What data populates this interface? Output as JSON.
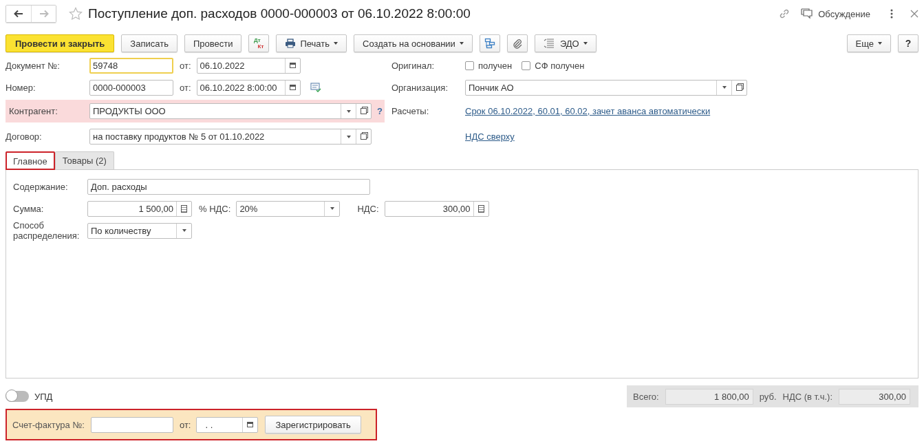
{
  "title": "Поступление доп. расходов 0000-000003 от 06.10.2022 8:00:00",
  "discussion": "Обсуждение",
  "toolbar": [
    {
      "kind": "primary",
      "label": "Провести и закрыть"
    },
    {
      "kind": "button",
      "label": "Записать"
    },
    {
      "kind": "button",
      "label": "Провести"
    },
    {
      "kind": "dtkt",
      "top": "Дт",
      "bottom": "Кт"
    },
    {
      "kind": "print",
      "label": "Печать"
    },
    {
      "kind": "menu",
      "label": "Создать на основании"
    },
    {
      "kind": "structure"
    },
    {
      "kind": "attach"
    },
    {
      "kind": "edo",
      "label": "ЭДО"
    }
  ],
  "toolbar_right": [
    {
      "kind": "menu",
      "label": "Еще"
    },
    {
      "kind": "button",
      "label": "?"
    }
  ],
  "doc_number": {
    "label": "Документ №:",
    "value": "59748",
    "focused": true,
    "date_label": "от:",
    "date": "06.10.2022"
  },
  "number": {
    "label": "Номер:",
    "value": "0000-000003",
    "date_label": "от:",
    "date": "06.10.2022  8:00:00"
  },
  "counterparty": {
    "label": "Контрагент:",
    "value": "ПРОДУКТЫ ООО",
    "error": true,
    "help": "?"
  },
  "contract": {
    "label": "Договор:",
    "value": "на поставку продуктов № 5 от 01.10.2022"
  },
  "original": {
    "label": "Оригинал:",
    "checkboxes": [
      {
        "label": "получен",
        "checked": false
      },
      {
        "label": "СФ получен",
        "checked": false
      }
    ]
  },
  "organization": {
    "label": "Организация:",
    "value": "Пончик АО"
  },
  "settlements": {
    "label": "Расчеты:",
    "link": "Срок 06.10.2022, 60.01, 60.02, зачет аванса автоматически"
  },
  "vat_link": "НДС сверху",
  "tabs": [
    {
      "label": "Главное",
      "selected": true,
      "highlighted": true
    },
    {
      "label": "Товары (2)",
      "selected": false,
      "highlighted": false
    }
  ],
  "main": {
    "content_label": "Содержание:",
    "content": "Доп. расходы",
    "sum_label": "Сумма:",
    "sum": "1 500,00",
    "vat_rate_label": "% НДС:",
    "vat_rate": "20%",
    "vat_label": "НДС:",
    "vat": "300,00",
    "method_label": "Способ распределения:",
    "method": "По количеству"
  },
  "upd": {
    "label": "УПД",
    "on": false
  },
  "totals": {
    "total_label": "Всего:",
    "total": "1 800,00",
    "currency": "руб.",
    "vat_label": "НДС (в т.ч.):",
    "vat": "300,00"
  },
  "invoice": {
    "label": "Счет-фактура №:",
    "date_label": "от:",
    "date": ". .",
    "button": "Зарегистрировать",
    "highlighted": true
  }
}
